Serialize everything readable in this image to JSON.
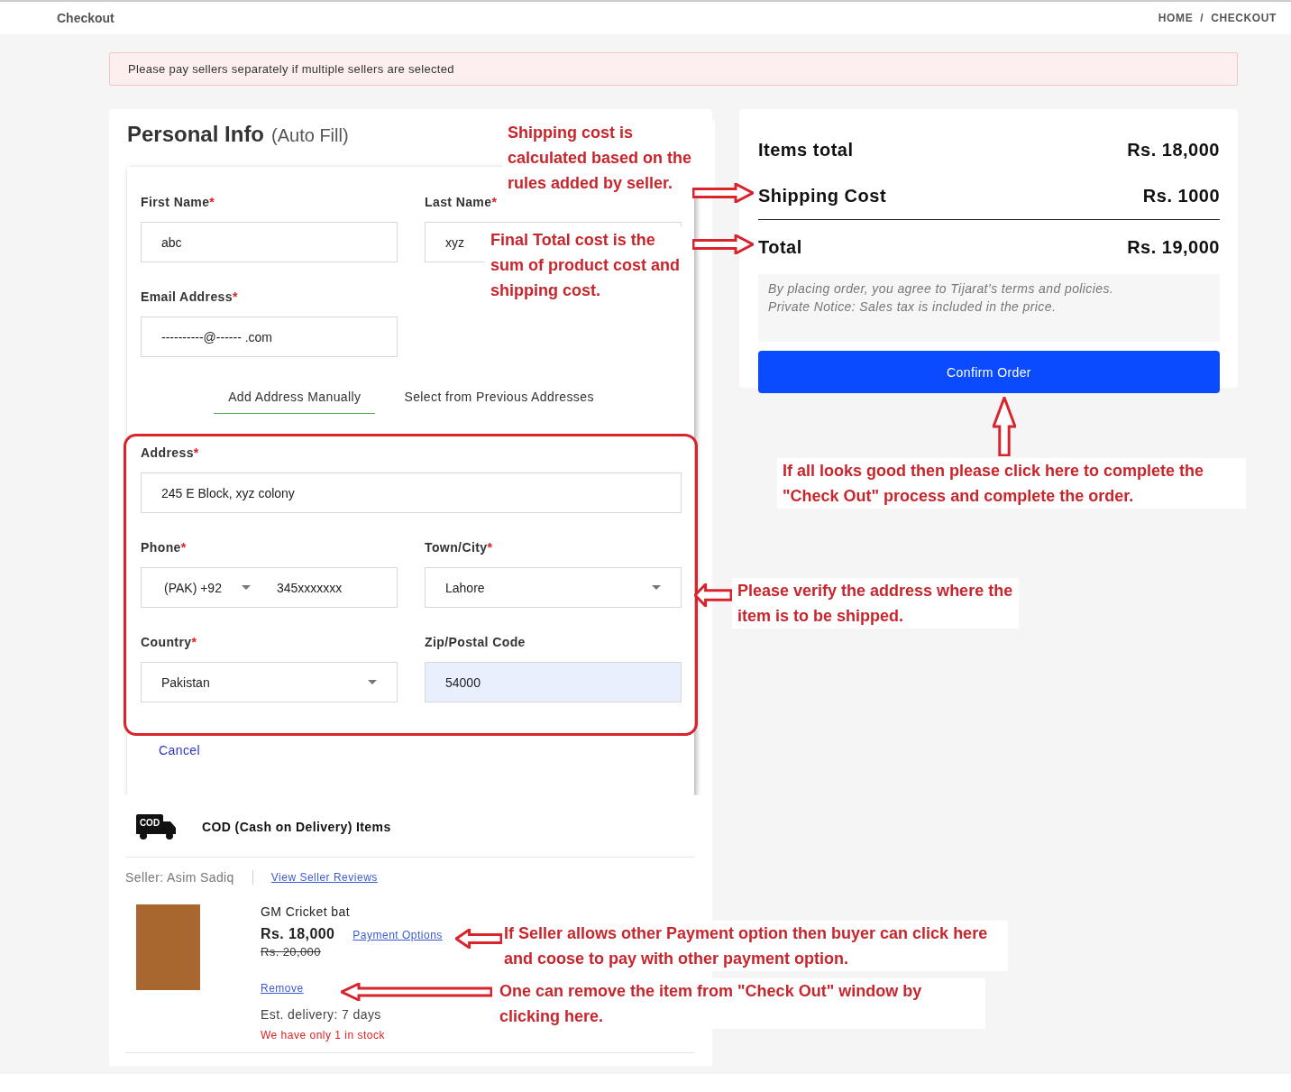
{
  "header": {
    "title": "Checkout",
    "breadcrumb": [
      "HOME",
      "CHECKOUT"
    ],
    "separator": "/"
  },
  "notice": "Please pay sellers separately if multiple sellers are selected",
  "personal_info": {
    "title": "Personal Info",
    "subtitle": "(Auto Fill)",
    "fields": [
      {
        "label": "First Name",
        "required_mark": "*",
        "kind": "text",
        "value": "abc"
      },
      {
        "label": "Last Name",
        "required_mark": "*",
        "kind": "text",
        "value": "xyz"
      },
      {
        "label": "Email Address",
        "required_mark": "*",
        "kind": "text",
        "value": "----------@------ .com"
      }
    ]
  },
  "address_tabs": [
    {
      "label": "Add Address Manually",
      "selected": true
    },
    {
      "label": "Select from Previous Addresses",
      "selected": false
    }
  ],
  "address_form": {
    "highlighted": true,
    "fields": [
      {
        "label": "Address",
        "required_mark": "*",
        "kind": "text",
        "value": "245 E Block, xyz colony",
        "autofilled": false
      },
      {
        "label": "Phone",
        "required_mark": "*",
        "kind": "phone",
        "code": "(PAK) +92",
        "value": "345xxxxxxx",
        "autofilled": false
      },
      {
        "label": "Town/City",
        "required_mark": "*",
        "kind": "select",
        "value": "Lahore",
        "autofilled": false
      },
      {
        "label": "Country",
        "required_mark": "*",
        "kind": "select",
        "value": "Pakistan",
        "autofilled": false
      },
      {
        "label": "Zip/Postal Code",
        "kind": "text",
        "value": "54000",
        "autofilled": true
      }
    ]
  },
  "cancel": "Cancel",
  "cod": {
    "icon_label": "COD",
    "title": "COD (Cash on Delivery) Items",
    "seller": "Seller: Asim Sadiq",
    "reviews_link": "View Seller Reviews",
    "items": [
      {
        "name": "GM Cricket bat",
        "price": "Rs. 18,000",
        "old_price": "Rs. 20,000",
        "payment_link": "Payment Options",
        "remove_link": "Remove",
        "delivery": "Est. delivery: 7 days",
        "stock": "We have only 1 in stock"
      }
    ]
  },
  "summary": {
    "rows": [
      {
        "label": "Items total",
        "value": "Rs. 18,000",
        "kind": "line"
      },
      {
        "label": "Shipping Cost",
        "value": "Rs. 1000",
        "kind": "line"
      },
      {
        "label": "Total",
        "value": "Rs. 19,000",
        "kind": "total"
      }
    ],
    "notes": [
      "By placing order, you agree to Tijarat’s terms and policies.",
      "Private Notice: Sales tax is included in the price."
    ],
    "button": "Confirm Order"
  },
  "annotations": [
    {
      "text": "Shipping cost is calculated based on the rules added by seller.",
      "kind": "arrow-right"
    },
    {
      "text": "Final Total cost is the sum of product cost and shipping cost.",
      "kind": "arrow-right"
    },
    {
      "text": "If all looks good then please click here to complete the \"Check Out\" process and complete the order.",
      "kind": "arrow-up"
    },
    {
      "text": "Please verify the address where the item is to be shipped.",
      "kind": "arrow-left"
    },
    {
      "text": "If Seller allows other Payment option then buyer can click here and coose to pay with other payment option.",
      "kind": "arrow-left"
    },
    {
      "text": "One can remove the item from \"Check Out\" window by clicking here.",
      "kind": "arrow-left"
    }
  ]
}
